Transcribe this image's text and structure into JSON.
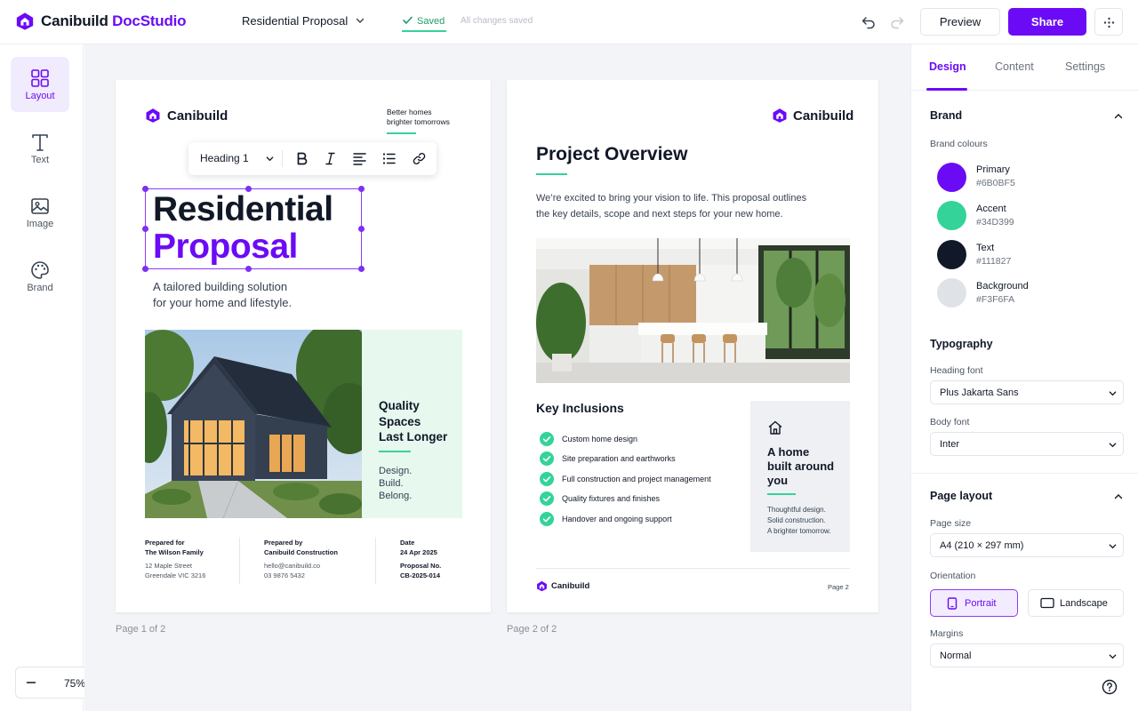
{
  "app": {
    "brand_word1": "Canibuild",
    "brand_word2": "DocStudio",
    "doc_title": "Residential Proposal",
    "saved_label": "Saved",
    "saved_note": "All changes saved",
    "preview_label": "Preview",
    "share_label": "Share",
    "accent_color": "#6B0BF5"
  },
  "rail": {
    "items": [
      {
        "label": "Layout",
        "icon": "layout-grid-icon"
      },
      {
        "label": "Text",
        "icon": "text-icon"
      },
      {
        "label": "Image",
        "icon": "image-icon"
      },
      {
        "label": "Brand",
        "icon": "palette-icon"
      }
    ],
    "active": "Layout"
  },
  "zoom": {
    "level": "75%"
  },
  "page1": {
    "brand": "Canibuild",
    "tagline": [
      "Better homes",
      "brighter tomorrows"
    ],
    "toolbar": {
      "block_type": "Heading 1"
    },
    "title_line1": "Residential",
    "title_line2": "Proposal",
    "subtitle": [
      "A tailored building solution",
      "for your home and lifestyle."
    ],
    "quality": {
      "title": [
        "Quality",
        "Spaces",
        "Last Longer"
      ],
      "lines": [
        "Design.",
        "Build.",
        "Belong."
      ]
    },
    "prepared_for": {
      "label": "Prepared for",
      "name": "The Wilson Family",
      "addr1": "12 Maple Street",
      "addr2": "Greendale VIC 3216"
    },
    "prepared_by": {
      "label": "Prepared by",
      "name": "Canibuild Construction",
      "email": "hello@canibuild.co",
      "phone": "03 9876 5432"
    },
    "meta": {
      "date_label": "Date",
      "date": "24 Apr 2025",
      "no_label": "Proposal No.",
      "no": "CB-2025-014"
    },
    "caption": "Page 1 of 2"
  },
  "page2": {
    "brand": "Canibuild",
    "title": "Project Overview",
    "intro": [
      "We’re excited to bring your vision to life. This proposal outlines",
      "the key details, scope and next steps for your new home."
    ],
    "inclusions_title": "Key Inclusions",
    "inclusions": [
      "Custom home design",
      "Site preparation and earthworks",
      "Full construction and project management",
      "Quality fixtures and finishes",
      "Handover and ongoing support"
    ],
    "card": {
      "title": [
        "A home",
        "built around",
        "you"
      ],
      "lines": [
        "Thoughtful design.",
        "Solid construction.",
        "A brighter tomorrow."
      ]
    },
    "footer_brand": "Canibuild",
    "footer_page": "Page 2",
    "caption": "Page 2 of 2"
  },
  "panel": {
    "tabs": [
      "Design",
      "Content",
      "Settings"
    ],
    "active_tab": "Design",
    "brand": {
      "title": "Brand",
      "colours_label": "Brand colours",
      "colours": [
        {
          "name": "Primary",
          "hex": "#6B0BF5"
        },
        {
          "name": "Accent",
          "hex": "#34D399"
        },
        {
          "name": "Text",
          "hex": "#111827"
        },
        {
          "name": "Background",
          "hex": "#F3F6FA"
        }
      ]
    },
    "typography": {
      "title": "Typography",
      "heading_label": "Heading font",
      "heading_value": "Plus Jakarta Sans",
      "body_label": "Body font",
      "body_value": "Inter"
    },
    "layout": {
      "title": "Page layout",
      "size_label": "Page size",
      "size_value": "A4 (210 × 297 mm)",
      "orientation_label": "Orientation",
      "portrait": "Portrait",
      "landscape": "Landscape",
      "orientation_selected": "Portrait",
      "margins_label": "Margins",
      "margins_value": "Normal"
    }
  }
}
